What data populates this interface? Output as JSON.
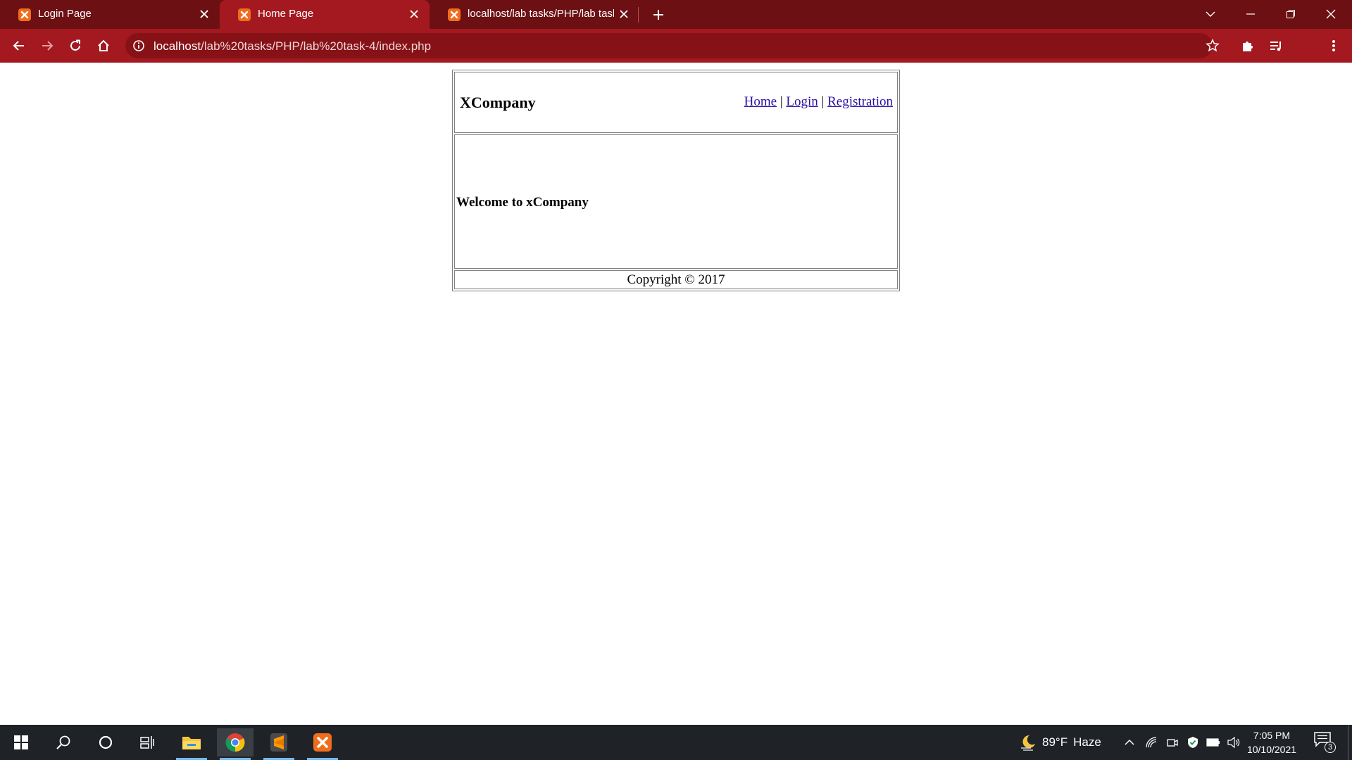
{
  "browser": {
    "tabs": [
      {
        "title": "Login Page",
        "active": false
      },
      {
        "title": "Home Page",
        "active": true
      },
      {
        "title": "localhost/lab tasks/PHP/lab task-",
        "active": false
      }
    ],
    "url_host": "localhost",
    "url_path": "/lab%20tasks/PHP/lab%20task-4/index.php",
    "colors": {
      "tabbar": "#6c1014",
      "toolbar": "#a3191f",
      "omnibox": "#861217"
    }
  },
  "page": {
    "brand": "XCompany",
    "nav": {
      "home": "Home",
      "separator": "|",
      "login": "Login",
      "registration": "Registration"
    },
    "welcome": "Welcome to xCompany",
    "copyright": "Copyright © 2017",
    "link_color": "#2b0fa0"
  },
  "taskbar": {
    "weather_temp": "89°F",
    "weather_desc": "Haze",
    "time": "7:05 PM",
    "date": "10/10/2021",
    "notification_count": "3"
  }
}
